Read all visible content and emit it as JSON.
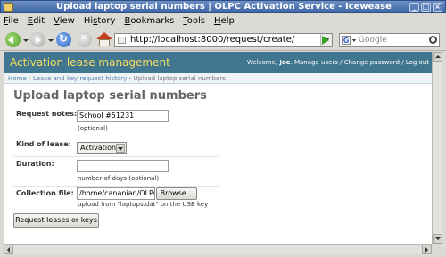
{
  "window": {
    "title": "Upload laptop serial numbers | OLPC Activation Service - Iceweasel"
  },
  "menubar": {
    "items": [
      "File",
      "Edit",
      "View",
      "History",
      "Bookmarks",
      "Tools",
      "Help"
    ],
    "mnemonics": [
      "F",
      "E",
      "V",
      "s",
      "B",
      "T",
      "H"
    ]
  },
  "toolbar": {
    "url": "http://localhost:8000/request/create/",
    "search_placeholder": "Google"
  },
  "site": {
    "title": "Activation lease management",
    "welcome": "Welcome,",
    "username": "Joe",
    "user_links": ". Manage users / Change password / Log out"
  },
  "breadcrumbs": {
    "home": "Home",
    "sep": "›",
    "history": "Lease and key request history",
    "current": "Upload laptop serial numbers"
  },
  "page": {
    "title": "Upload laptop serial numbers"
  },
  "form": {
    "request_notes_label": "Request notes:",
    "request_notes_value": "School #51231",
    "request_notes_help": "(optional)",
    "kind_label": "Kind of lease:",
    "kind_value": "Activation",
    "duration_label": "Duration:",
    "duration_value": "",
    "duration_help": "number of days (optional)",
    "collection_label": "Collection file:",
    "collection_value": "/home/cananian/OLPC/",
    "browse_label": "Browse...",
    "collection_help": "upload from \"laptops.dat\" on the USB key",
    "submit_label": "Request leases or keys"
  },
  "colors": {
    "header_bg": "#417690",
    "header_title": "#f5dd5d",
    "breadcrumb_bg": "#eef3f6",
    "link": "#5b80b2"
  }
}
